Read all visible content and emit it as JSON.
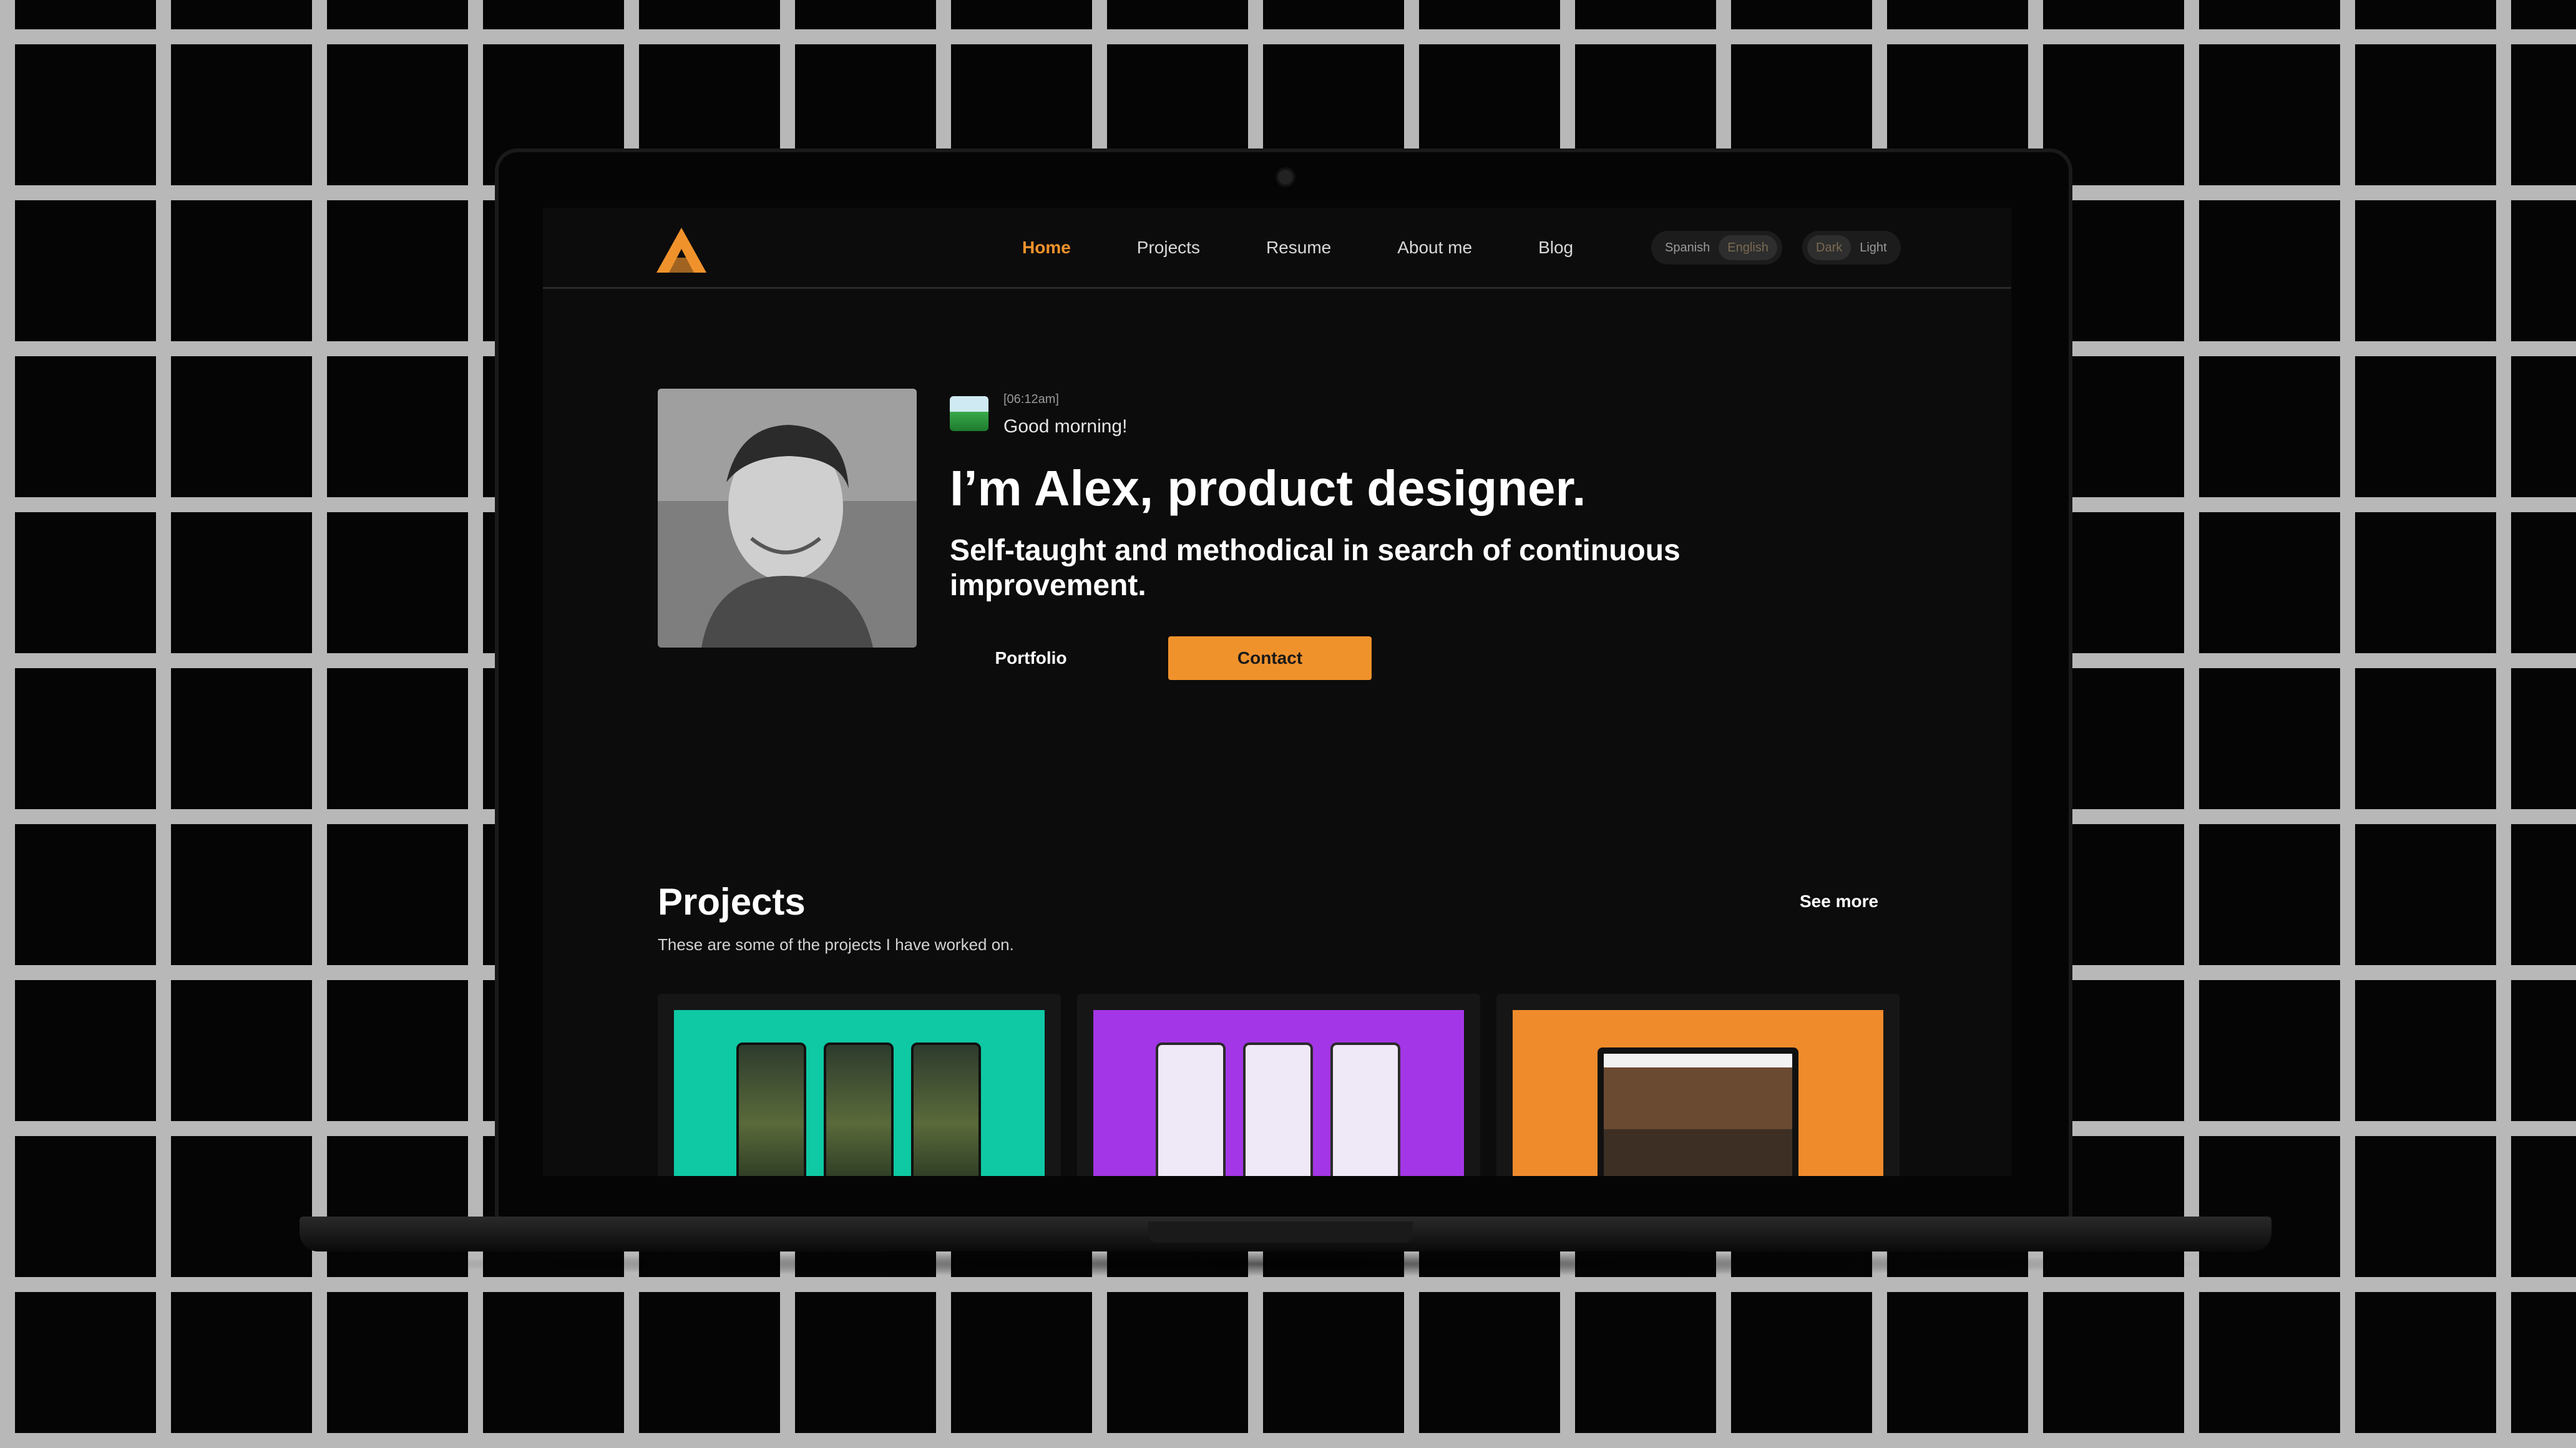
{
  "nav": {
    "logo_icon": "a-logo-icon",
    "links": [
      "Home",
      "Projects",
      "Resume",
      "About me",
      "Blog"
    ],
    "active": "Home",
    "language": {
      "options": [
        "Spanish",
        "English"
      ],
      "selected": "English"
    },
    "theme": {
      "options": [
        "Dark",
        "Light"
      ],
      "selected": "Dark"
    }
  },
  "hero": {
    "time": "[06:12am]",
    "time_icon": "landscape-icon",
    "greeting": "Good morning!",
    "headline": "I’m Alex, product designer.",
    "subhead": "Self-taught and methodical in search of continuous improvement.",
    "portfolio_label": "Portfolio",
    "contact_label": "Contact"
  },
  "projects": {
    "title": "Projects",
    "description": "These are some of the projects I have worked on.",
    "see_more_label": "See more"
  },
  "colors": {
    "accent": "#f0922c",
    "background": "#0c0c0c",
    "card_teal": "#0ec9a3",
    "card_purple": "#a336e6",
    "card_orange": "#f08b2c"
  }
}
